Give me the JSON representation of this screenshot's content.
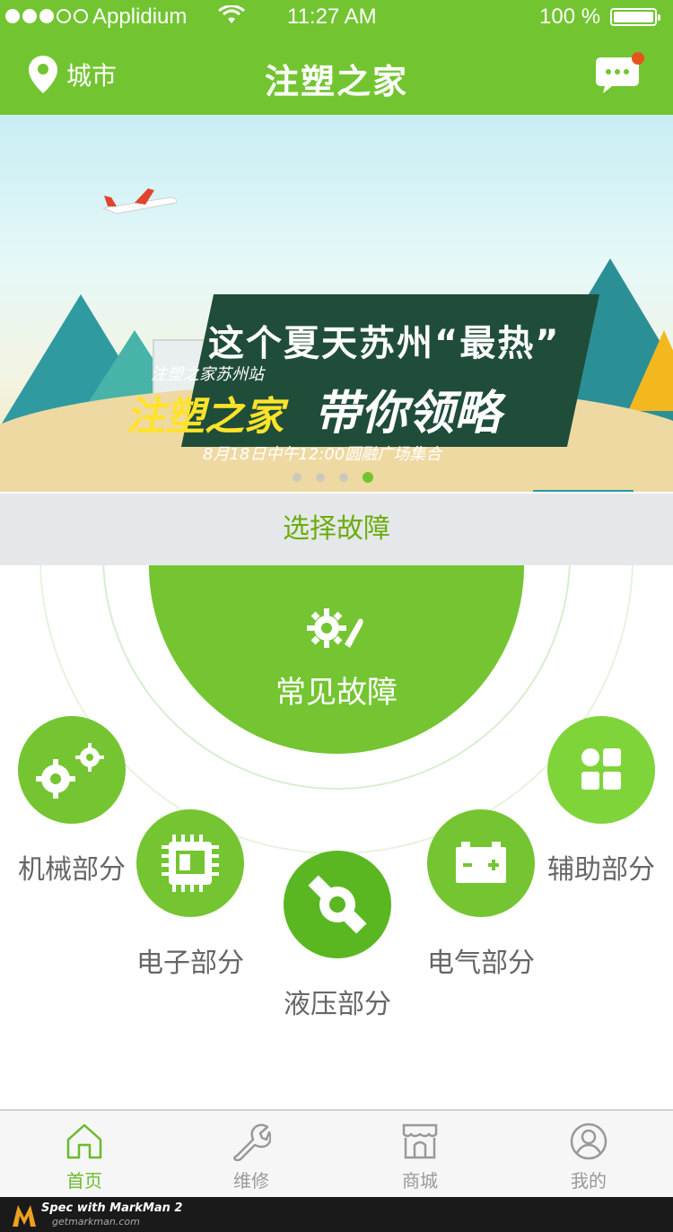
{
  "status": {
    "carrier": "Applidium",
    "time": "11:27 AM",
    "battery": "100 %"
  },
  "nav": {
    "city_label": "城市",
    "title": "注塑之家",
    "icons": {
      "location": "location-pin-icon",
      "message": "message-bubble-icon"
    }
  },
  "banner": {
    "headline_1": "这个夏天苏州“最热”",
    "tagline": "注塑之家苏州站",
    "headline_2": "注塑之家",
    "headline_3": "带你领略",
    "event": "8月18日中午12:00圆融广场集合",
    "slide_count": 4,
    "active_slide": 4
  },
  "section": {
    "title": "选择故障"
  },
  "faults": {
    "center": {
      "label": "常见故障",
      "icon": "gear-wrench-icon"
    },
    "nodes": [
      {
        "id": "mechanical",
        "label": "机械部分",
        "icon": "gears-icon"
      },
      {
        "id": "electronic",
        "label": "电子部分",
        "icon": "chip-icon"
      },
      {
        "id": "hydraulic",
        "label": "液压部分",
        "icon": "hydraulic-icon"
      },
      {
        "id": "electrical",
        "label": "电气部分",
        "icon": "battery-icon"
      },
      {
        "id": "auxiliary",
        "label": "辅助部分",
        "icon": "grid-icon"
      }
    ]
  },
  "tabs": [
    {
      "label": "首页",
      "icon": "home-icon",
      "active": true
    },
    {
      "label": "维修",
      "icon": "wrench-icon",
      "active": false
    },
    {
      "label": "商城",
      "icon": "store-icon",
      "active": false
    },
    {
      "label": "我的",
      "icon": "user-icon",
      "active": false
    }
  ],
  "footer": {
    "brand_line": "Spec with MarkMan 2",
    "site": "getmarkman.com"
  },
  "colors": {
    "primary": "#72c530",
    "section_bg": "#e5e8ea",
    "section_text": "#6cad0c",
    "label_text": "#666666",
    "tab_active": "#6aba2b",
    "tab_inactive": "#999999",
    "tabbar_bg": "#f6f6f6",
    "divider": "#d2d2d2"
  }
}
